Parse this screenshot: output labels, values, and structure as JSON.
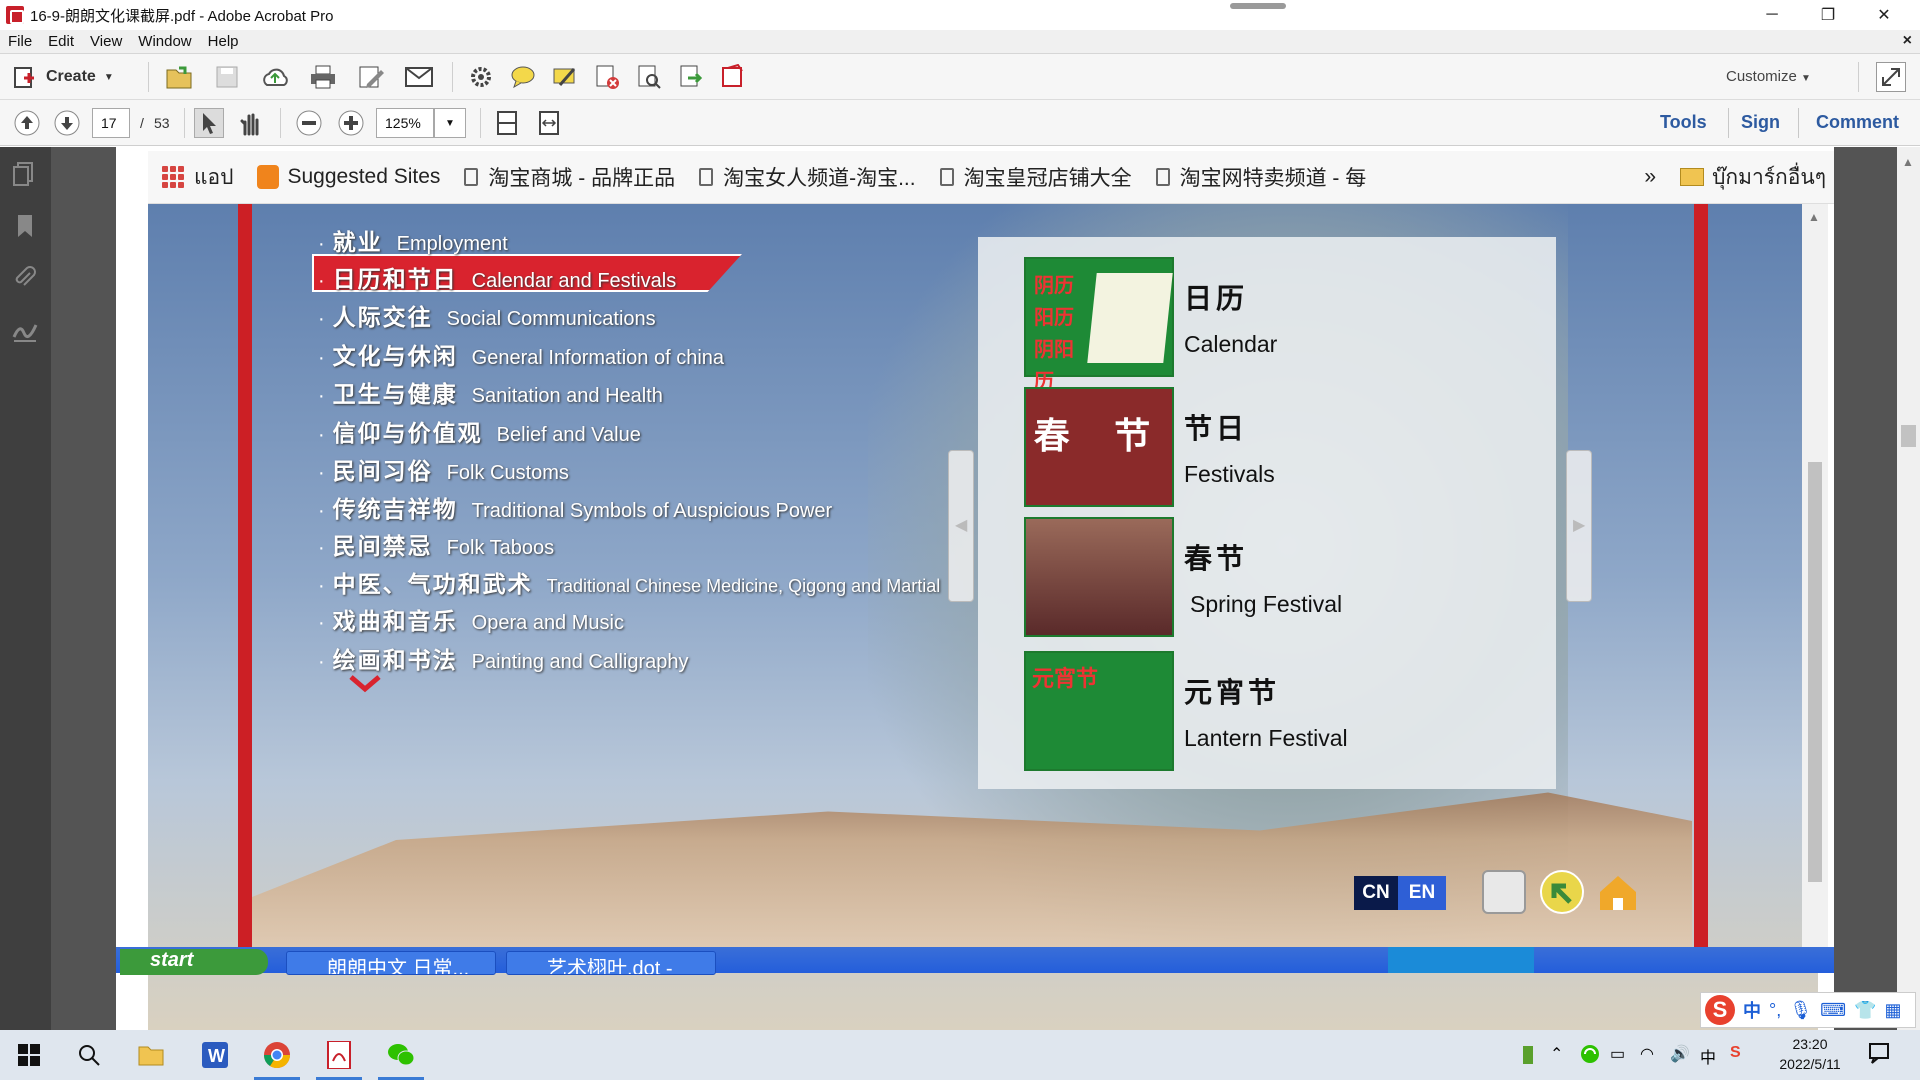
{
  "window": {
    "title": "16-9-朗朗文化课截屏.pdf - Adobe Acrobat Pro",
    "minimize": "─",
    "restore": "❐",
    "close": "✕"
  },
  "menubar": {
    "items": [
      "File",
      "Edit",
      "View",
      "Window",
      "Help"
    ],
    "close_doc": "×"
  },
  "toolbar": {
    "create_label": "Create",
    "customize_label": "Customize",
    "page_current": "17",
    "page_total": "53",
    "page_sep": "/",
    "zoom": "125%",
    "tools_label": "Tools",
    "sign_label": "Sign",
    "comment_label": "Comment"
  },
  "browser_bookmarks": {
    "apps_label": "แอป",
    "items": [
      "Suggested Sites",
      "淘宝商城 - 品牌正品",
      "淘宝女人频道-淘宝...",
      "淘宝皇冠店铺大全",
      "淘宝网特卖频道 - 每"
    ],
    "overflow": "»",
    "other_folder": "บุ๊กมาร์กอื่นๆ"
  },
  "slide": {
    "menu": [
      {
        "cn": "就业",
        "en": "Employment"
      },
      {
        "cn": "日历和节日",
        "en": "Calendar and Festivals",
        "active": true
      },
      {
        "cn": "人际交往",
        "en": "Social Communications"
      },
      {
        "cn": "文化与休闲",
        "en": "General Information of china"
      },
      {
        "cn": "卫生与健康",
        "en": "Sanitation and Health"
      },
      {
        "cn": "信仰与价值观",
        "en": "Belief and Value"
      },
      {
        "cn": "民间习俗",
        "en": "Folk Customs"
      },
      {
        "cn": "传统吉祥物",
        "en": "Traditional Symbols of Auspicious Power"
      },
      {
        "cn": "民间禁忌",
        "en": "Folk Taboos"
      },
      {
        "cn": "中医、气功和武术",
        "en": "Traditional Chinese Medicine, Qigong and Martial"
      },
      {
        "cn": "戏曲和音乐",
        "en": "Opera and Music"
      },
      {
        "cn": "绘画和书法",
        "en": "Painting and Calligraphy"
      }
    ],
    "bullet": "·",
    "topics": [
      {
        "cn": "日历",
        "en": "Calendar",
        "thumb_text": "阴历 阳历 阴阳历"
      },
      {
        "cn": "节日",
        "en": "Festivals",
        "thumb_text": "春 节"
      },
      {
        "cn": "春节",
        "en": "Spring Festival",
        "thumb_text": ""
      },
      {
        "cn": "元宵节",
        "en": "Lantern Festival",
        "thumb_text": "元宵节"
      }
    ],
    "lang_cn": "CN",
    "lang_en": "EN",
    "xp_start": "start",
    "xp_tasks": [
      "朗朗中文 日常...",
      "艺术栩叶.dot -"
    ]
  },
  "taskbar": {
    "time": "23:20",
    "date": "2022/5/11",
    "ime_label": "中"
  },
  "colors": {
    "accent_red": "#cc1f25",
    "acrobat_link_blue": "#2d5aa0"
  }
}
